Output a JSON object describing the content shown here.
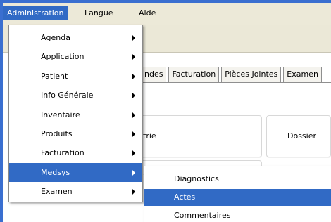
{
  "menubar": {
    "items": [
      {
        "label": "Administration"
      },
      {
        "label": "Langue"
      },
      {
        "label": "Aide"
      }
    ]
  },
  "dropdown": {
    "items": [
      {
        "label": "Agenda"
      },
      {
        "label": "Application"
      },
      {
        "label": "Patient"
      },
      {
        "label": "Info Générale"
      },
      {
        "label": "Inventaire"
      },
      {
        "label": "Produits"
      },
      {
        "label": "Facturation"
      },
      {
        "label": "Medsys"
      },
      {
        "label": "Examen"
      }
    ]
  },
  "submenu": {
    "items": [
      {
        "label": "Diagnostics"
      },
      {
        "label": "Actes"
      },
      {
        "label": "Commentaires"
      }
    ]
  },
  "tabs": [
    {
      "label": "ndes"
    },
    {
      "label": "Facturation"
    },
    {
      "label": "Pièces Jointes"
    },
    {
      "label": "Examen"
    }
  ],
  "panels": {
    "left_label": "trie",
    "right_label": "Dossier"
  },
  "colors": {
    "highlight": "#316ac5",
    "menubar_bg": "#ece9d8",
    "window_border": "#3a6fd0"
  }
}
